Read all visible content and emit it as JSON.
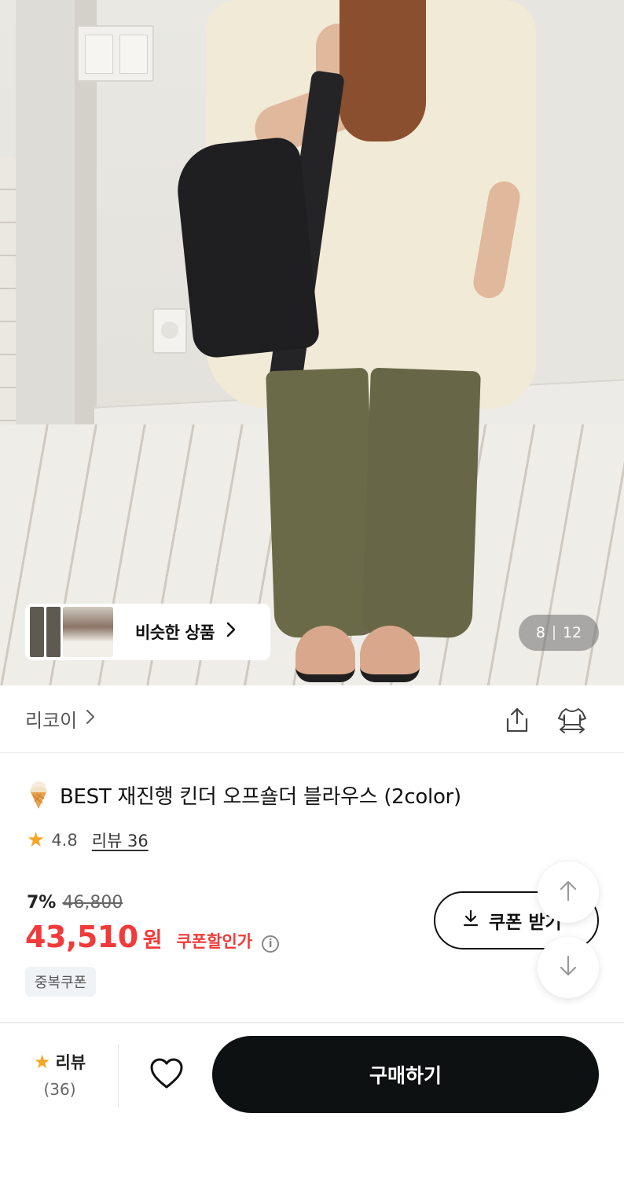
{
  "hero": {
    "similar_label": "비슷한 상품",
    "image_index": "8",
    "image_total": "12"
  },
  "store": {
    "name": "리코이"
  },
  "product": {
    "title": "BEST 재진행 킨더 오프숄더 블라우스 (2color)",
    "rating": "4.8",
    "review_link": "리뷰 36"
  },
  "price": {
    "discount_rate": "7%",
    "original": "46,800",
    "current": "43,510",
    "unit": "원",
    "coupon_label": "쿠폰할인가",
    "duplicate_coupon": "중복쿠폰"
  },
  "coupon_button": {
    "label": "쿠폰 받기"
  },
  "bottom_bar": {
    "review_label": "리뷰",
    "review_count": "(36)",
    "buy_label": "구매하기"
  },
  "colors": {
    "price_red": "#f23a3a",
    "star": "#f5a623",
    "buy_button": "#0e1111"
  },
  "icons": [
    "chevron-right-icon",
    "share-icon",
    "compare-icon",
    "ice-cream-icon",
    "star-icon",
    "info-icon",
    "download-icon",
    "arrow-up-icon",
    "arrow-down-icon",
    "heart-icon"
  ]
}
